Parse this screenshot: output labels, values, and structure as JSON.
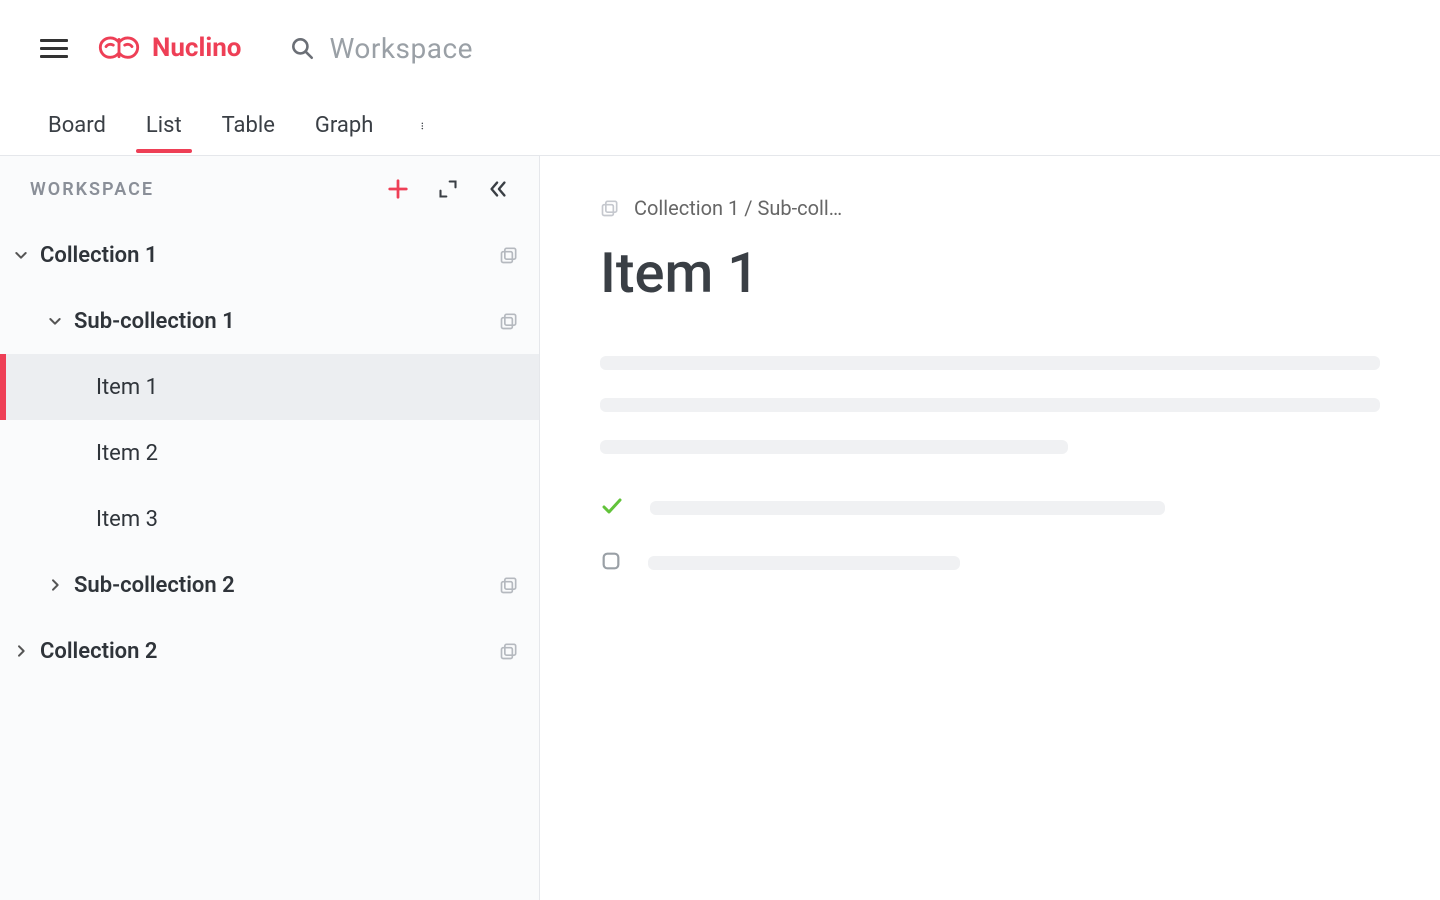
{
  "brand": {
    "name": "Nuclino"
  },
  "search": {
    "placeholder": "Workspace"
  },
  "tabs": {
    "items": [
      "Board",
      "List",
      "Table",
      "Graph"
    ],
    "active_index": 1
  },
  "sidebar": {
    "title": "WORKSPACE",
    "tree": [
      {
        "label": "Collection 1",
        "expanded": true,
        "has_stack_icon": true,
        "children": [
          {
            "label": "Sub-collection 1",
            "expanded": true,
            "has_stack_icon": true,
            "children": [
              {
                "label": "Item 1",
                "selected": true
              },
              {
                "label": "Item 2"
              },
              {
                "label": "Item 3"
              }
            ]
          },
          {
            "label": "Sub-collection 2",
            "expanded": false,
            "has_stack_icon": true
          }
        ]
      },
      {
        "label": "Collection 2",
        "expanded": false,
        "has_stack_icon": true
      }
    ]
  },
  "document": {
    "breadcrumb": "Collection 1 / Sub-coll…",
    "title": "Item 1"
  },
  "colors": {
    "accent": "#ee3f56",
    "check_green": "#62c33a"
  }
}
